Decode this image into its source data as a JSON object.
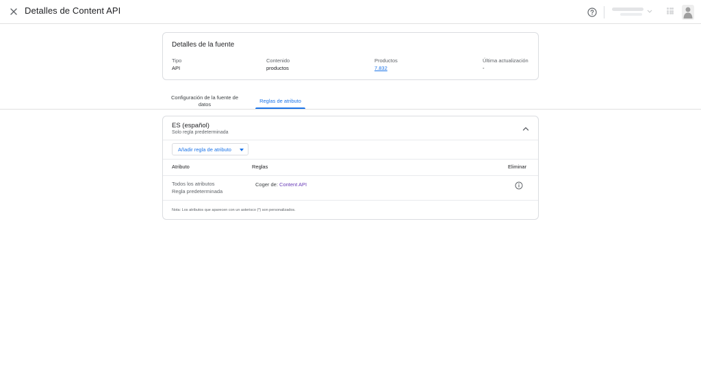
{
  "header": {
    "title": "Detalles de Content API"
  },
  "details": {
    "title": "Detalles de la fuente",
    "columns": [
      {
        "label": "Tipo",
        "value": "API"
      },
      {
        "label": "Contenido",
        "value": "productos"
      },
      {
        "label": "Productos",
        "value": "7.832"
      },
      {
        "label": "Última actualización",
        "value": "-"
      }
    ]
  },
  "tabs": [
    {
      "label": "Configuración de la fuente de datos",
      "active": false
    },
    {
      "label": "Reglas de atributo",
      "active": true
    }
  ],
  "rules_section": {
    "language_title": "ES (español)",
    "language_subtitle": "Solo regla predeterminada",
    "add_rule_label": "Añadir regla de atributo",
    "table": {
      "headers": {
        "attribute": "Atributo",
        "rules": "Reglas",
        "delete": "Eliminar"
      },
      "rows": [
        {
          "attribute": "Todos los atributos",
          "attribute_sub": "Regla predeterminada",
          "rule_prefix": "Coger de:",
          "rule_source": "Content API"
        }
      ]
    },
    "note": "Nota: Los atributos que aparecen con un asterisco (*) son personalizados."
  },
  "colors": {
    "accent": "#1a73e8",
    "rule_link": "#673ab7",
    "border": "#dadce0"
  },
  "icons": {
    "close": "close-icon",
    "help": "help-icon",
    "apps": "apps-icon",
    "avatar": "avatar-icon",
    "collapse": "chevron-up-icon",
    "dropdown": "caret-down-icon",
    "info": "info-icon"
  }
}
